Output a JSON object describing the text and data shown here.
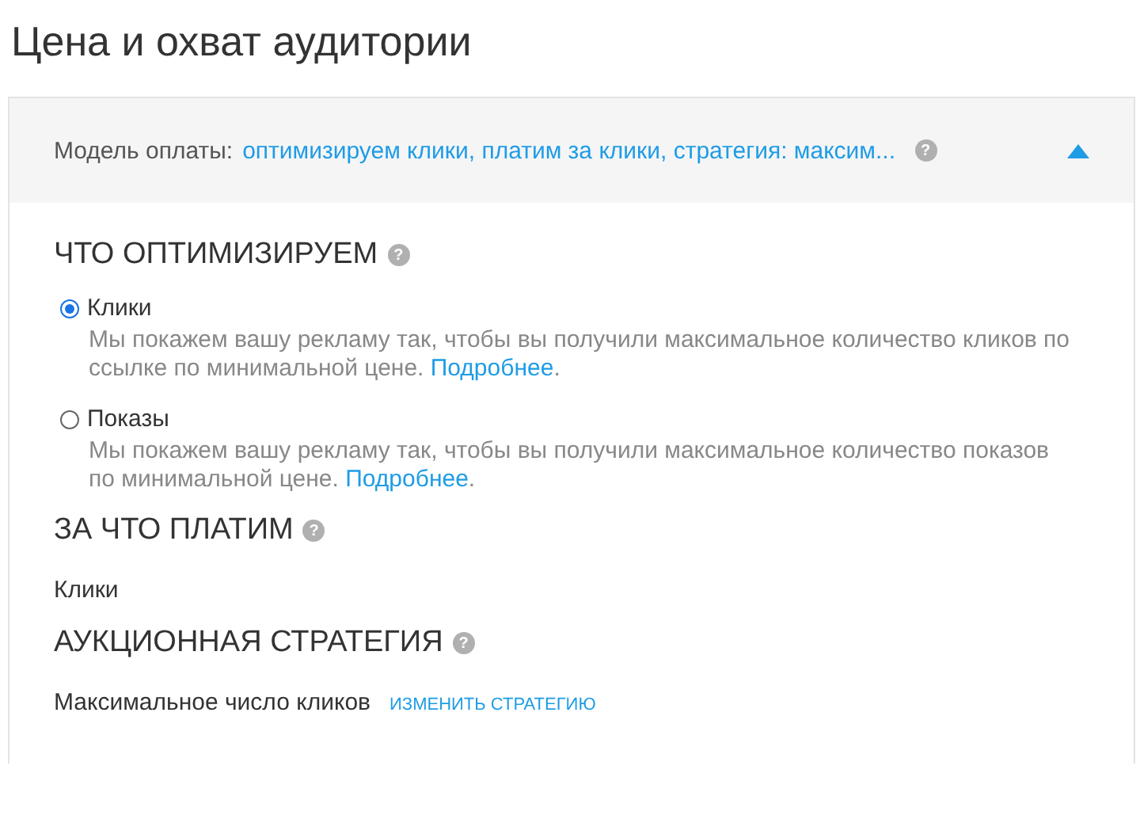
{
  "title": "Цена и охват аудитории",
  "panel": {
    "expanded": true,
    "label": "Модель оплаты:",
    "summary": "оптимизируем клики, платим за клики, стратегия: максим...",
    "help": "?"
  },
  "sections": [
    {
      "kind": "radios",
      "heading": "ЧТО ОПТИМИЗИРУЕМ",
      "help": "?",
      "options": [
        {
          "label": "Клики",
          "selected": true,
          "description": "Мы покажем вашу рекламу так, чтобы вы получили максимальное количество кликов по ссылке по минимальной цене.",
          "link": "Подробнее",
          "tail": "."
        },
        {
          "label": "Показы",
          "selected": false,
          "description": "Мы покажем вашу рекламу так, чтобы вы получили максимальное количество показов по минимальной цене.",
          "link": "Подробнее",
          "tail": "."
        }
      ]
    },
    {
      "kind": "value",
      "heading": "ЗА ЧТО ПЛАТИМ",
      "help": "?",
      "value": "Клики"
    },
    {
      "kind": "value",
      "heading": "АУКЦИОННАЯ СТРАТЕГИЯ",
      "help": "?",
      "value": "Максимальное число кликов",
      "action": "ИЗМЕНИТЬ СТРАТЕГИЮ"
    }
  ]
}
